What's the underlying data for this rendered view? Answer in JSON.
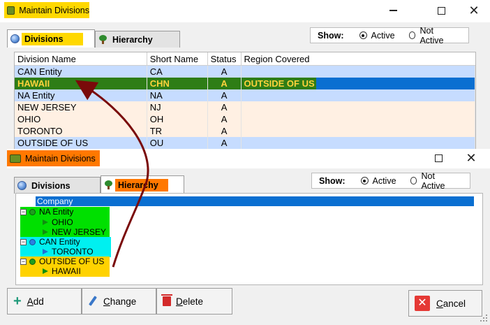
{
  "window1": {
    "title": "Maintain Divisions",
    "minimize_glyph": "—",
    "close_glyph": "✕",
    "tabs": [
      {
        "label": "Divisions",
        "icon": "globe-icon",
        "active": true
      },
      {
        "label": "Hierarchy",
        "icon": "tree-icon",
        "active": false
      }
    ],
    "show": {
      "label": "Show:",
      "options": [
        {
          "label": "Active",
          "selected": true
        },
        {
          "label": "Not Active",
          "selected": false
        }
      ]
    },
    "grid": {
      "columns": [
        "Division Name",
        "Short Name",
        "Status",
        "Region Covered"
      ],
      "rows": [
        {
          "name": "CAN Entity",
          "short": "CA",
          "status": "A",
          "region": ""
        },
        {
          "name": "HAWAII",
          "short": "CHN",
          "status": "A",
          "region": "OUTSIDE  OF US"
        },
        {
          "name": "NA Entity",
          "short": "NA",
          "status": "A",
          "region": ""
        },
        {
          "name": "NEW JERSEY",
          "short": "NJ",
          "status": "A",
          "region": ""
        },
        {
          "name": "OHIO",
          "short": "OH",
          "status": "A",
          "region": ""
        },
        {
          "name": "TORONTO",
          "short": "TR",
          "status": "A",
          "region": ""
        },
        {
          "name": "OUTSIDE OF US",
          "short": "OU",
          "status": "A",
          "region": ""
        }
      ]
    }
  },
  "window2": {
    "title": "Maintain Divisions",
    "close_glyph": "✕",
    "tabs": [
      {
        "label": "Divisions",
        "icon": "globe-icon",
        "active": false
      },
      {
        "label": "Hierarchy",
        "icon": "tree-icon",
        "active": true
      }
    ],
    "show": {
      "label": "Show:",
      "options": [
        {
          "label": "Active",
          "selected": true
        },
        {
          "label": "Not Active",
          "selected": false
        }
      ]
    },
    "tree": {
      "root": "Company",
      "groups": [
        {
          "label": "NA Entity",
          "expander": "−",
          "children": [
            "OHIO",
            "NEW JERSEY"
          ],
          "highlight": "#00e000"
        },
        {
          "label": "CAN Entity",
          "expander": "−",
          "children": [
            "TORONTO"
          ],
          "highlight": "#00f0f0"
        },
        {
          "label": "OUTSIDE OF US",
          "expander": "−",
          "children": [
            "HAWAII"
          ],
          "highlight": "#ffd200"
        }
      ]
    }
  },
  "buttons": {
    "add": {
      "label_ul": "A",
      "label_rest": "dd",
      "icon": "plus-icon"
    },
    "change": {
      "label_ul": "C",
      "label_rest": "hange",
      "icon": "pencil-icon"
    },
    "delete": {
      "label_ul": "D",
      "label_rest": "elete",
      "icon": "trash-icon"
    },
    "cancel": {
      "label_ul": "C",
      "label_rest": "ancel",
      "icon": "cancel-x-icon"
    }
  },
  "colors": {
    "title_highlight_1": "#ffd800",
    "title_highlight_2": "#ff7800",
    "selection_blue": "#0a6fd1",
    "row_blue": "#c6dcff",
    "row_peach": "#fff0e3",
    "arrow": "#7a0a0a"
  }
}
